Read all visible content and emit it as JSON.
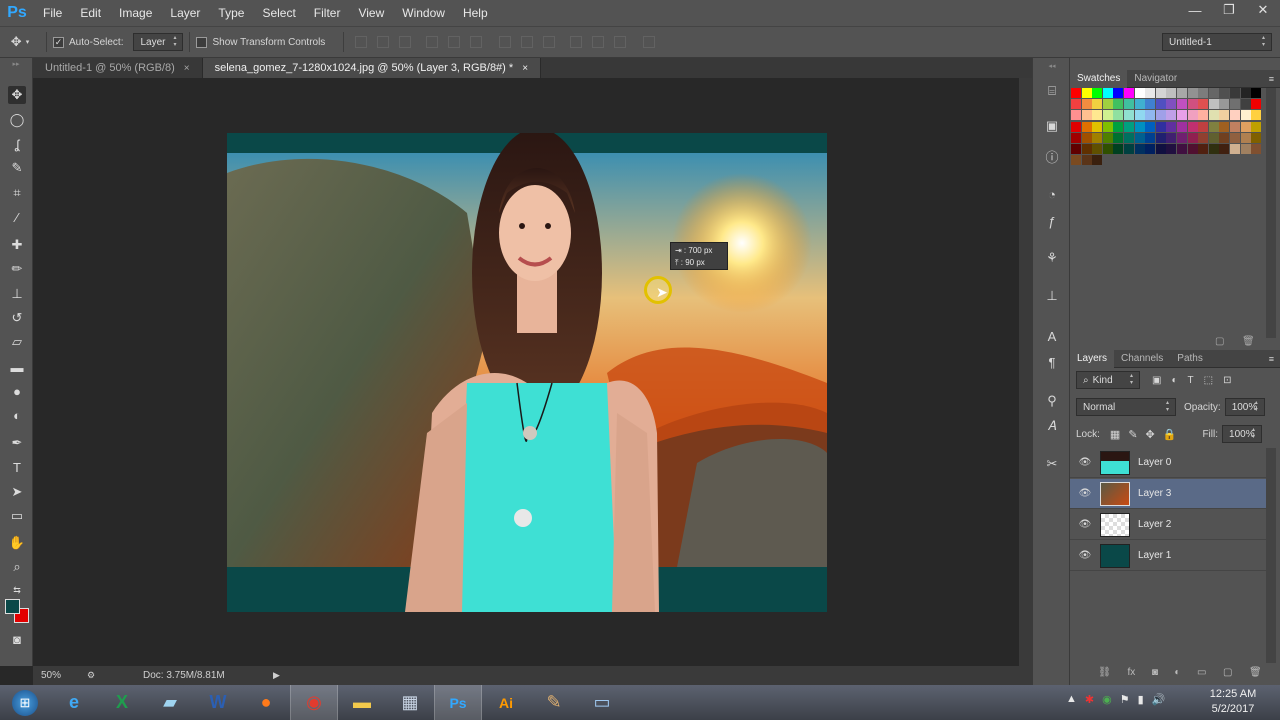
{
  "menubar": {
    "logo": "Ps",
    "items": [
      "File",
      "Edit",
      "Image",
      "Layer",
      "Type",
      "Select",
      "Filter",
      "View",
      "Window",
      "Help"
    ]
  },
  "window_controls": {
    "minimize": "—",
    "restore": "❐",
    "close": "✕"
  },
  "options_bar": {
    "auto_select_label": "Auto-Select:",
    "auto_select_checked": "✓",
    "auto_select_target": "Layer",
    "show_transform_label": "Show Transform Controls",
    "workspace": "Untitled-1"
  },
  "tabs": [
    {
      "label": "Untitled-1 @ 50% (RGB/8)",
      "close": "×"
    },
    {
      "label": "selena_gomez_7-1280x1024.jpg @ 50% (Layer 3, RGB/8#) *",
      "close": "×"
    }
  ],
  "move_readout": {
    "x": "700 px",
    "y": "90 px"
  },
  "status": {
    "zoom": "50%",
    "doc": "Doc: 3.75M/8.81M"
  },
  "swatches_panel": {
    "tabs": [
      "Swatches",
      "Navigator"
    ]
  },
  "layers_panel": {
    "tabs": [
      "Layers",
      "Channels",
      "Paths"
    ],
    "filter": "Kind",
    "blend_mode": "Normal",
    "opacity_label": "Opacity:",
    "opacity": "100%",
    "lock_label": "Lock:",
    "fill_label": "Fill:",
    "fill": "100%",
    "layers": [
      {
        "name": "Layer 0",
        "selected": false
      },
      {
        "name": "Layer 3",
        "selected": true
      },
      {
        "name": "Layer 2",
        "selected": false
      },
      {
        "name": "Layer 1",
        "selected": false
      }
    ]
  },
  "colors": {
    "foreground": "#0a4848",
    "background": "#e30000"
  },
  "taskbar": {
    "time": "12:25 AM",
    "date": "5/2/2017"
  }
}
